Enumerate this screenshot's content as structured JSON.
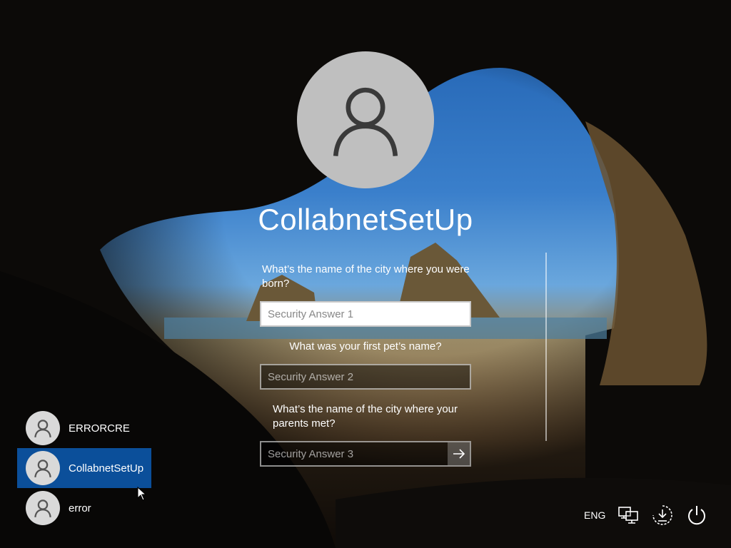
{
  "user": {
    "name": "CollabnetSetUp"
  },
  "security": {
    "questions": [
      "What’s the name of the city where you were born?",
      "What was your first pet’s name?",
      "What’s the name of the city where your parents met?"
    ],
    "placeholders": [
      "Security Answer 1",
      "Security Answer 2",
      "Security Answer 3"
    ]
  },
  "accounts": [
    {
      "name": "ERRORCRE"
    },
    {
      "name": "CollabnetSetUp"
    },
    {
      "name": "error"
    }
  ],
  "tray": {
    "language": "ENG"
  },
  "colors": {
    "selected_account": "#0b4f9a"
  }
}
